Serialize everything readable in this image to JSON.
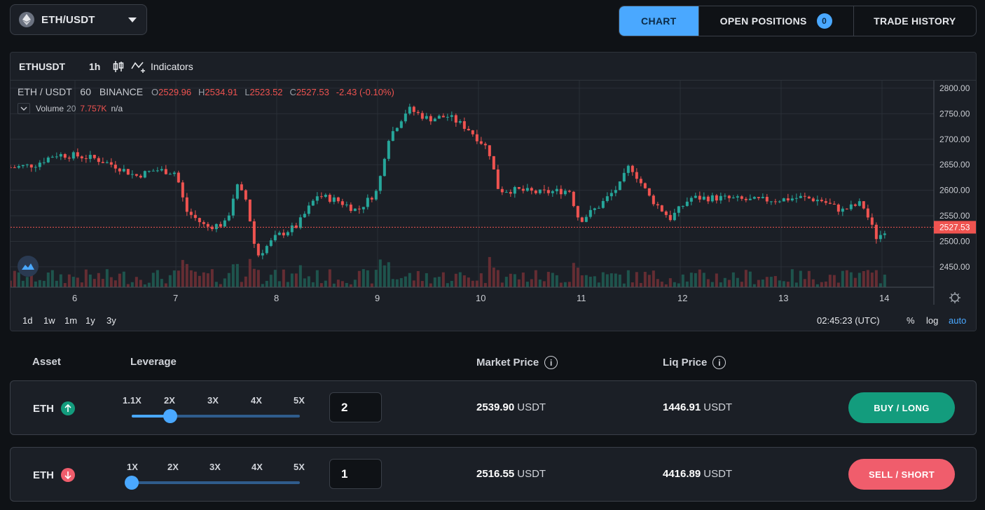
{
  "pair": {
    "label": "ETH/USDT"
  },
  "tabs": [
    {
      "label": "CHART"
    },
    {
      "label": "OPEN POSITIONS",
      "count": "0"
    },
    {
      "label": "TRADE HISTORY"
    }
  ],
  "chart": {
    "symbol": "ETHUSDT",
    "timeframe": "1h",
    "indicators_label": "Indicators",
    "legend": {
      "title": "ETH / USDT",
      "interval": "60",
      "exchange": "BINANCE",
      "o_label": "O",
      "o": "2529.96",
      "h_label": "H",
      "h": "2534.91",
      "l_label": "L",
      "l": "2523.52",
      "c_label": "C",
      "c": "2527.53",
      "change": "-2.43 (-0.10%)"
    },
    "volume": {
      "label": "Volume",
      "period": "20",
      "value": "7.757K",
      "extra": "n/a"
    },
    "current_price": "2527.53",
    "ranges": [
      "1d",
      "1w",
      "1m",
      "1y",
      "3y"
    ],
    "time": "02:45:23 (UTC)",
    "pct": "%",
    "log": "log",
    "auto": "auto"
  },
  "chart_data": {
    "type": "candlestick",
    "title": "ETH / USDT",
    "interval": "60",
    "exchange": "BINANCE",
    "x_ticks": [
      "6",
      "7",
      "8",
      "9",
      "10",
      "11",
      "12",
      "13",
      "14"
    ],
    "y_ticks": [
      "2800.00",
      "2750.00",
      "2700.00",
      "2650.00",
      "2600.00",
      "2550.00",
      "2500.00",
      "2450.00"
    ],
    "ylim": [
      2410,
      2815
    ],
    "grid": true,
    "current_price": 2527.53,
    "close_path": [
      [
        "5.4",
        2645
      ],
      [
        "5.6",
        2650
      ],
      [
        "5.8",
        2670
      ],
      [
        "6.0",
        2668
      ],
      [
        "6.2",
        2662
      ],
      [
        "6.4",
        2648
      ],
      [
        "6.6",
        2628
      ],
      [
        "6.8",
        2640
      ],
      [
        "7.0",
        2635
      ],
      [
        "7.1",
        2560
      ],
      [
        "7.3",
        2528
      ],
      [
        "7.5",
        2535
      ],
      [
        "7.6",
        2610
      ],
      [
        "7.7",
        2580
      ],
      [
        "7.8",
        2470
      ],
      [
        "8.0",
        2510
      ],
      [
        "8.2",
        2530
      ],
      [
        "8.4",
        2590
      ],
      [
        "8.6",
        2580
      ],
      [
        "8.8",
        2560
      ],
      [
        "9.0",
        2600
      ],
      [
        "9.1",
        2700
      ],
      [
        "9.3",
        2760
      ],
      [
        "9.5",
        2740
      ],
      [
        "9.7",
        2745
      ],
      [
        "9.9",
        2720
      ],
      [
        "10.1",
        2680
      ],
      [
        "10.2",
        2600
      ],
      [
        "10.4",
        2600
      ],
      [
        "10.6",
        2595
      ],
      [
        "10.9",
        2600
      ],
      [
        "11.0",
        2540
      ],
      [
        "11.2",
        2570
      ],
      [
        "11.4",
        2610
      ],
      [
        "11.5",
        2650
      ],
      [
        "11.7",
        2585
      ],
      [
        "11.9",
        2545
      ],
      [
        "12.1",
        2585
      ],
      [
        "12.4",
        2585
      ],
      [
        "12.7",
        2580
      ],
      [
        "13.0",
        2582
      ],
      [
        "13.2",
        2586
      ],
      [
        "13.4",
        2580
      ],
      [
        "13.6",
        2560
      ],
      [
        "13.8",
        2575
      ],
      [
        "13.95",
        2505
      ],
      [
        "14.05",
        2527.53
      ]
    ],
    "volume_label": "Volume",
    "volume_period": 20,
    "volume_last": "7.757K"
  },
  "trade": {
    "headers": {
      "asset": "Asset",
      "leverage": "Leverage",
      "market_price": "Market Price",
      "liq_price": "Liq Price"
    },
    "long": {
      "asset": "ETH",
      "lev_labels": [
        "1.1X",
        "2X",
        "3X",
        "4X",
        "5X"
      ],
      "leverage_value": "2",
      "leverage_fraction": 0.23,
      "market_price": "2539.90",
      "liq_price": "1446.91",
      "unit": "USDT",
      "button": "BUY / LONG",
      "color": "#139c7d"
    },
    "short": {
      "asset": "ETH",
      "lev_labels": [
        "1X",
        "2X",
        "3X",
        "4X",
        "5X"
      ],
      "leverage_value": "1",
      "leverage_fraction": 0.0,
      "market_price": "2516.55",
      "liq_price": "4416.89",
      "unit": "USDT",
      "button": "SELL / SHORT",
      "color": "#f05d6c"
    }
  }
}
